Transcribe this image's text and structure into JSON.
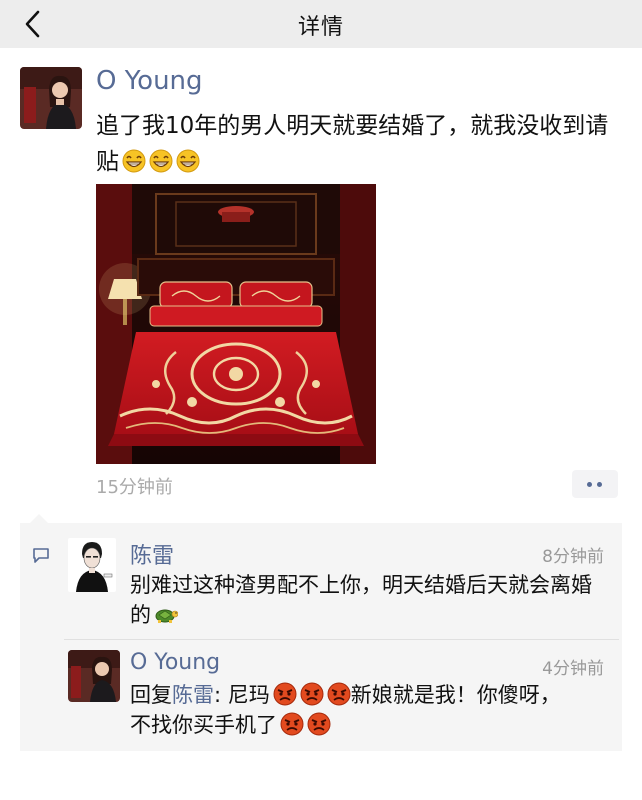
{
  "nav": {
    "title": "详情",
    "back_icon": "chevron-left-icon"
  },
  "post": {
    "author": "O Young",
    "text": "追了我10年的男人明天就要结婚了，就我没收到请贴",
    "emoji": [
      "grin-emoji",
      "grin-emoji",
      "grin-emoji"
    ],
    "image_subject": "red-wedding-bedding-photo",
    "time": "15分钟前",
    "more_icon": "two-dots-icon"
  },
  "comments": {
    "icon": "comment-icon",
    "items": [
      {
        "author": "陈雷",
        "time": "8分钟前",
        "text": "别难过这种渣男配不上你，明天结婚后天就会离婚的",
        "trailing_emoji": "turtle-emoji"
      },
      {
        "author": "O Young",
        "time": "4分钟前",
        "reply_prefix": "回复",
        "reply_to": "陈雷",
        "reply_colon": ": ",
        "text_part1": "尼玛",
        "angry_emoji_1": [
          "angry-emoji",
          "angry-emoji",
          "angry-emoji"
        ],
        "text_part2": "新娘就是我！你傻呀，",
        "text_part3": "不找你买手机了",
        "angry_emoji_2": [
          "angry-emoji",
          "angry-emoji"
        ]
      }
    ]
  },
  "colors": {
    "nav_bg": "#ededed",
    "link_blue": "#576b95",
    "comment_bg": "#f5f5f5",
    "bedding_red": "#c8141e"
  }
}
